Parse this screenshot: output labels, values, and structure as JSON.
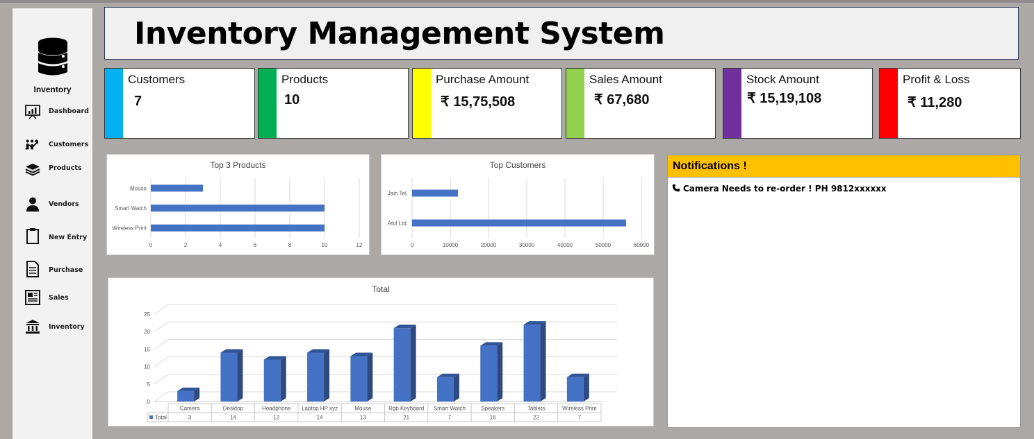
{
  "app": {
    "brand": "Inventory",
    "title": "Inventory Management System"
  },
  "sidebar": {
    "items": [
      {
        "label": "Dashboard",
        "icon": "presentation-chart-icon"
      },
      {
        "label": "Customers",
        "icon": "people-growth-icon"
      },
      {
        "label": "Products",
        "icon": "stacked-books-icon"
      },
      {
        "label": "Vendors",
        "icon": "person-icon"
      },
      {
        "label": "New Entry",
        "icon": "clipboard-icon"
      },
      {
        "label": "Purchase",
        "icon": "document-icon"
      },
      {
        "label": "Sales",
        "icon": "newspaper-icon"
      },
      {
        "label": "Inventory",
        "icon": "bank-icon"
      }
    ]
  },
  "kpis": [
    {
      "label": "Customers",
      "value": "7",
      "color": "#00b0f0"
    },
    {
      "label": "Products",
      "value": "10",
      "color": "#00b050"
    },
    {
      "label": "Purchase Amount",
      "value": "₹ 15,75,508",
      "color": "#ffff00"
    },
    {
      "label": "Sales Amount",
      "value": "₹ 67,680",
      "color": "#92d050"
    },
    {
      "label": "Stock Amount",
      "value": "₹ 15,19,108",
      "color": "#7030a0"
    },
    {
      "label": "Profit & Loss",
      "value": "₹ 11,280",
      "color": "#ff0000"
    }
  ],
  "notifications": {
    "title": "Notifications !",
    "items": [
      {
        "icon": "phone-icon",
        "text": "Camera Needs to re-order ! PH 9812xxxxxx"
      }
    ]
  },
  "chart_data": [
    {
      "type": "bar",
      "orientation": "horizontal",
      "title": "Top 3 Products",
      "categories": [
        "Mouse",
        "Smart Watch",
        "Wireless Print"
      ],
      "values": [
        3,
        10,
        10
      ],
      "xlim": [
        0,
        12
      ],
      "xticks": [
        "0",
        "2",
        "4",
        "6",
        "8",
        "10",
        "12"
      ],
      "grid": true,
      "color": "#4472c4"
    },
    {
      "type": "bar",
      "orientation": "horizontal",
      "title": "Top Customers",
      "categories": [
        "Jain Tel.",
        "Atul Ltd."
      ],
      "values": [
        12000,
        56000
      ],
      "xlim": [
        0,
        60000
      ],
      "xticks": [
        "0",
        "10000",
        "20000",
        "30000",
        "40000",
        "50000",
        "60000"
      ],
      "grid": true,
      "color": "#4472c4"
    },
    {
      "type": "bar",
      "style": "3d-column",
      "title": "Total",
      "categories": [
        "Camera",
        "Desktop",
        "Headphone",
        "Laptop HP xyz",
        "Mouse",
        "Rgb Keyboard",
        "Smart Watch",
        "Speakers",
        "Tablets",
        "Wireless Print"
      ],
      "series": [
        {
          "name": "Total",
          "values": [
            3,
            14,
            12,
            14,
            13,
            21,
            7,
            16,
            22,
            7
          ]
        }
      ],
      "value_labels": [
        "3",
        "14",
        "12",
        "14",
        "13",
        "21",
        "7",
        "16",
        "22",
        "7"
      ],
      "ylim": [
        0,
        25
      ],
      "yticks": [
        "0",
        "5",
        "10",
        "15",
        "20",
        "25"
      ],
      "grid": true,
      "data_table": true,
      "color": "#4472c4"
    }
  ]
}
